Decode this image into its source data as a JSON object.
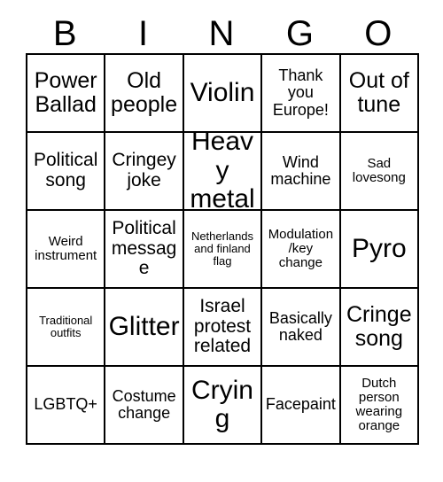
{
  "card": {
    "title": "BINGO",
    "header_letters": [
      "B",
      "I",
      "N",
      "G",
      "O"
    ],
    "columns": 5,
    "rows": 5,
    "border_color": "#000000",
    "background_color": "#ffffff",
    "text_color": "#000000",
    "cells": [
      {
        "row": 1,
        "col": 1,
        "column_letter": "B",
        "text": "Power Ballad",
        "size": "xl"
      },
      {
        "row": 1,
        "col": 2,
        "column_letter": "I",
        "text": "Old people",
        "size": "xl"
      },
      {
        "row": 1,
        "col": 3,
        "column_letter": "N",
        "text": "Violin",
        "size": "xxl"
      },
      {
        "row": 1,
        "col": 4,
        "column_letter": "G",
        "text": "Thank you Europe!",
        "size": "m"
      },
      {
        "row": 1,
        "col": 5,
        "column_letter": "O",
        "text": "Out of tune",
        "size": "xl"
      },
      {
        "row": 2,
        "col": 1,
        "column_letter": "B",
        "text": "Political song",
        "size": "l"
      },
      {
        "row": 2,
        "col": 2,
        "column_letter": "I",
        "text": "Cringey joke",
        "size": "l"
      },
      {
        "row": 2,
        "col": 3,
        "column_letter": "N",
        "text": "Heavy metal",
        "size": "xxl"
      },
      {
        "row": 2,
        "col": 4,
        "column_letter": "G",
        "text": "Wind machine",
        "size": "m"
      },
      {
        "row": 2,
        "col": 5,
        "column_letter": "O",
        "text": "Sad lovesong",
        "size": "s"
      },
      {
        "row": 3,
        "col": 1,
        "column_letter": "B",
        "text": "Weird instrument",
        "size": "s"
      },
      {
        "row": 3,
        "col": 2,
        "column_letter": "I",
        "text": "Political message",
        "size": "l"
      },
      {
        "row": 3,
        "col": 3,
        "column_letter": "N",
        "text": "Netherlands and finland flag",
        "size": "xs"
      },
      {
        "row": 3,
        "col": 4,
        "column_letter": "G",
        "text": "Modulation /key change",
        "size": "s"
      },
      {
        "row": 3,
        "col": 5,
        "column_letter": "O",
        "text": "Pyro",
        "size": "xxl"
      },
      {
        "row": 4,
        "col": 1,
        "column_letter": "B",
        "text": "Traditional outfits",
        "size": "xs"
      },
      {
        "row": 4,
        "col": 2,
        "column_letter": "I",
        "text": "Glitter",
        "size": "xxl"
      },
      {
        "row": 4,
        "col": 3,
        "column_letter": "N",
        "text": "Israel protest related",
        "size": "l"
      },
      {
        "row": 4,
        "col": 4,
        "column_letter": "G",
        "text": "Basically naked",
        "size": "m"
      },
      {
        "row": 4,
        "col": 5,
        "column_letter": "O",
        "text": "Cringe song",
        "size": "xl"
      },
      {
        "row": 5,
        "col": 1,
        "column_letter": "B",
        "text": "LGBTQ+",
        "size": "m"
      },
      {
        "row": 5,
        "col": 2,
        "column_letter": "I",
        "text": "Costume change",
        "size": "m"
      },
      {
        "row": 5,
        "col": 3,
        "column_letter": "N",
        "text": "Crying",
        "size": "xxl"
      },
      {
        "row": 5,
        "col": 4,
        "column_letter": "G",
        "text": "Facepaint",
        "size": "m"
      },
      {
        "row": 5,
        "col": 5,
        "column_letter": "O",
        "text": "Dutch person wearing orange",
        "size": "s"
      }
    ]
  }
}
